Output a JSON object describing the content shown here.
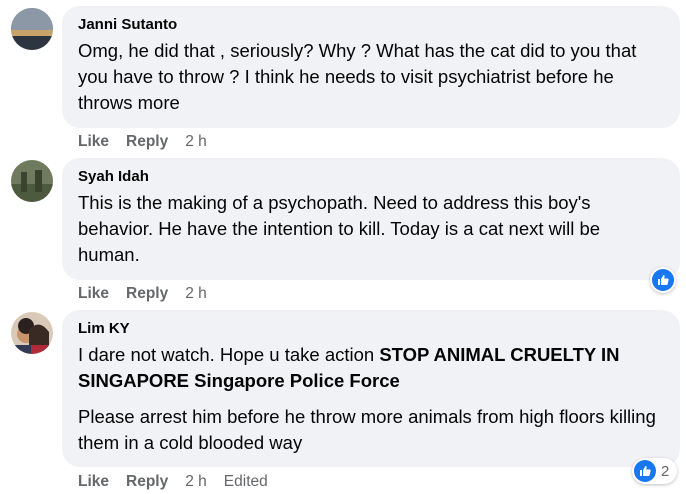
{
  "comments": [
    {
      "author": "Janni Sutanto",
      "text": "Omg, he did that , seriously? Why ? What has the cat did to you that you have to throw ? I think he needs to visit psychiatrist before he throws more",
      "actions": {
        "like": "Like",
        "reply": "Reply",
        "time": "2 h"
      }
    },
    {
      "author": "Syah Idah",
      "text": "This is the making of a psychopath. Need to address this boy's behavior. He have the intention to kill. Today is a cat next will be human.",
      "actions": {
        "like": "Like",
        "reply": "Reply",
        "time": "2 h"
      },
      "reaction": {
        "icon": "like-icon"
      }
    },
    {
      "author": "Lim KY",
      "text_plain": "I dare not watch. Hope u take action ",
      "mention_1": "STOP ANIMAL CRUELTY IN SINGAPORE",
      "mention_sep": " ",
      "mention_2": "Singapore Police Force",
      "text_2": "Please arrest him before he throw more animals from high floors killing them in a cold blooded way",
      "actions": {
        "like": "Like",
        "reply": "Reply",
        "time": "2 h",
        "edited": "Edited"
      },
      "reaction": {
        "icon": "like-icon",
        "count": "2"
      }
    }
  ],
  "colors": {
    "bubble": "#f0f2f5",
    "meta": "#65676b",
    "like_blue": "#1877f2"
  }
}
